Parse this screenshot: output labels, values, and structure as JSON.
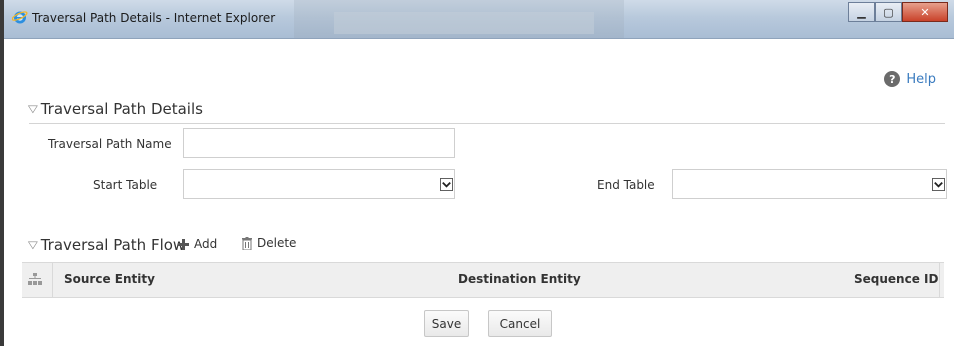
{
  "window": {
    "title": "Traversal Path Details - Internet Explorer",
    "minimize_glyph": "▁",
    "maximize_glyph": "▢",
    "close_glyph": "✕"
  },
  "help": {
    "label": "Help",
    "icon": "help-icon",
    "glyph": "?"
  },
  "details_section": {
    "title": "Traversal Path Details",
    "fields": {
      "path_name_label": "Traversal Path Name",
      "path_name_value": "",
      "start_table_label": "Start Table",
      "start_table_value": "",
      "end_table_label": "End Table",
      "end_table_value": ""
    }
  },
  "flow_section": {
    "title": "Traversal Path Flow",
    "add_label": "Add",
    "delete_label": "Delete",
    "columns": [
      "Source Entity",
      "Destination Entity",
      "Sequence ID"
    ],
    "rows": []
  },
  "footer": {
    "save_label": "Save",
    "cancel_label": "Cancel"
  },
  "colors": {
    "link": "#3a7bbf",
    "close": "#c9422a",
    "header_bg": "#efefef"
  }
}
